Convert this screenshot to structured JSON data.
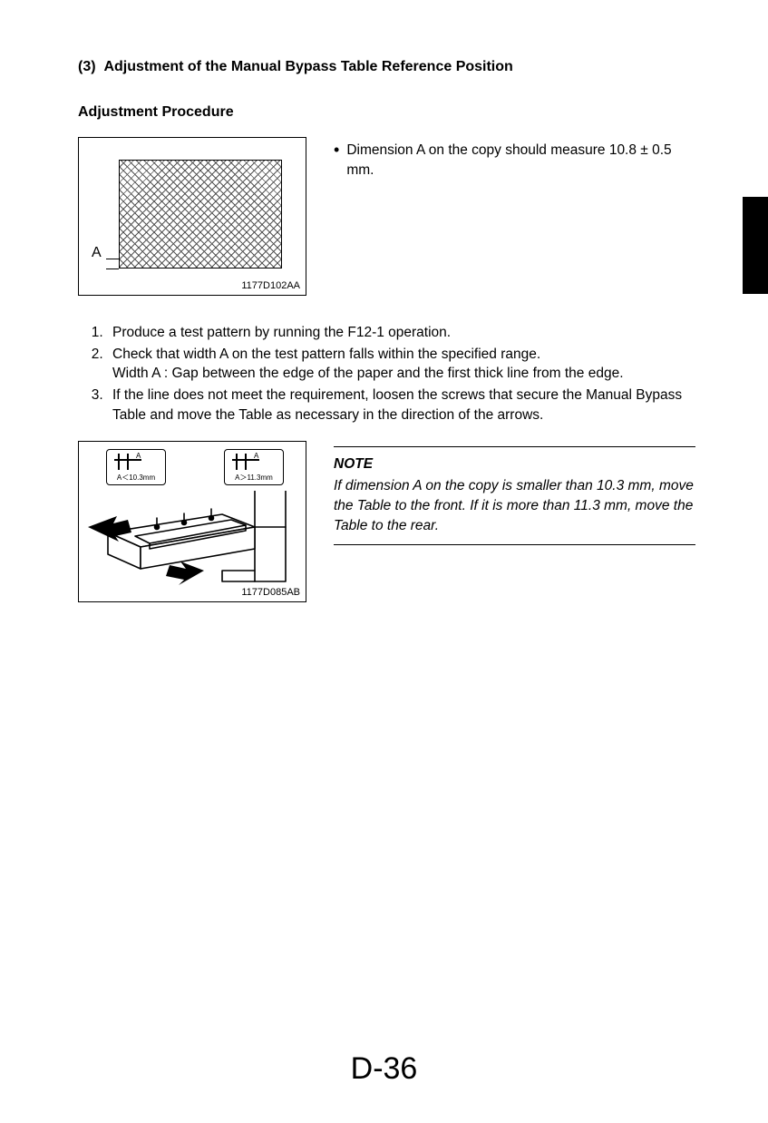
{
  "section": {
    "number": "(3)",
    "title": "Adjustment of the Manual Bypass Table Reference Position"
  },
  "subheading": "Adjustment Procedure",
  "figure1": {
    "dim_label": "A",
    "code": "1177D102AA"
  },
  "bullet": {
    "text": "Dimension A on the copy should measure 10.8 ± 0.5 mm."
  },
  "steps": [
    {
      "text": "Produce a test pattern by running the F12-1 operation."
    },
    {
      "text": "Check that width A on the test pattern falls within the specified range.",
      "sub": "Width A : Gap between the edge of the paper and the first thick line from the edge."
    },
    {
      "text": "If the line does not meet the requirement, loosen the screws that secure the Manual Bypass Table and move the Table as necessary in the direction of the arrows."
    }
  ],
  "figure2": {
    "left_label_a": "A",
    "left_text": "A＜10.3mm",
    "right_label_a": "A",
    "right_text": "A＞11.3mm",
    "code": "1177D085AB"
  },
  "note": {
    "title": "NOTE",
    "text": "If dimension A on the copy is smaller than 10.3 mm, move the Table to the front. If it is more than 11.3 mm, move the Table to the rear."
  },
  "page_number": "D-36"
}
